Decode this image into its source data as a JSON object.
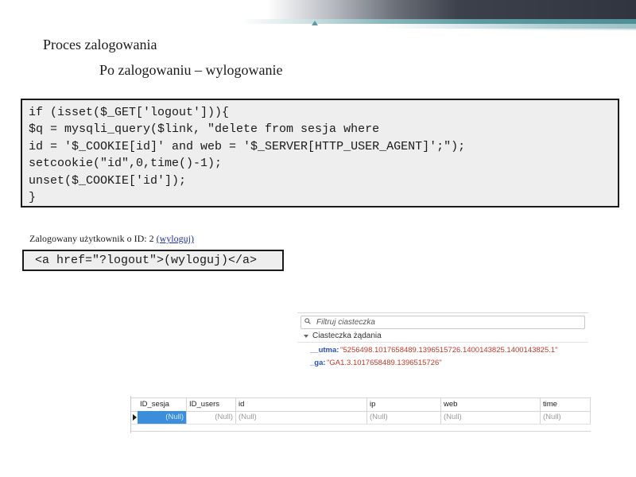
{
  "slide": {
    "title": "Proces zalogowania",
    "subtitle": "Po zalogowaniu – wylogowanie"
  },
  "code": {
    "lines": [
      "if (isset($_GET['logout'])){",
      "$q = mysqli_query($link, \"delete from sesja where",
      "id = '$_COOKIE[id]' and web = '$_SERVER[HTTP_USER_AGENT]';\");",
      "setcookie(\"id\",0,time()-1);",
      "unset($_COOKIE['id']);",
      "}"
    ]
  },
  "logged": {
    "text": "Zalogowany użytkownik o ID: 2 ",
    "link_label": "(wyloguj)"
  },
  "href_code": "<a href=\"?logout\">(wyloguj)</a>",
  "cookies": {
    "filter_placeholder": "Filtruj ciasteczka",
    "section_label": "Ciasteczka żądania",
    "items": [
      {
        "name": "__utma:",
        "value": "\"5256498.1017658489.1396515726.1400143825.1400143825.1\""
      },
      {
        "name": "_ga:",
        "value": "\"GA1.3.1017658489.1396515726\""
      }
    ]
  },
  "db": {
    "columns": [
      "ID_sesja",
      "ID_users",
      "id",
      "ip",
      "web",
      "time"
    ],
    "row": [
      "(Null)",
      "(Null)",
      "(Null)",
      "(Null)",
      "(Null)",
      "(Null)"
    ]
  }
}
